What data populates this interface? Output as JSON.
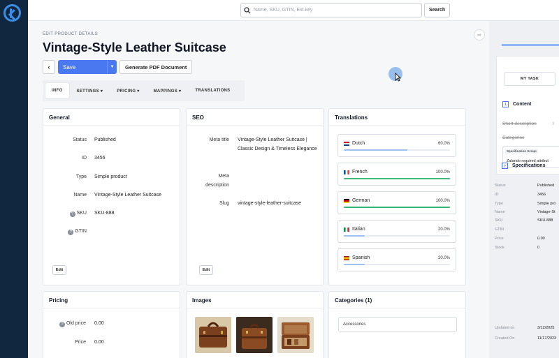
{
  "search": {
    "placeholder": "Name, SKU, GTIN, Ext.key",
    "button": "Search"
  },
  "page": {
    "breadcrumb": "EDIT PRODUCT DETAILS",
    "title": "Vintage-Style Leather Suitcase"
  },
  "toolbar": {
    "back": "‹",
    "save": "Save",
    "pdf": "Generate PDF Document"
  },
  "tabs": [
    {
      "label": "INFO",
      "active": true
    },
    {
      "label": "SETTINGS ▾"
    },
    {
      "label": "PRICING ▾"
    },
    {
      "label": "MAPPINGS ▾"
    },
    {
      "label": "TRANSLATIONS"
    }
  ],
  "general": {
    "title": "General",
    "status_label": "Status",
    "status": "Published",
    "id_label": "ID",
    "id": "3456",
    "type_label": "Type",
    "type": "Simple product",
    "name_label": "Name",
    "name": "Vintage-Style Leather Suitcase",
    "sku_label": "SKU",
    "sku": "SKU-888",
    "gtin_label": "GTIN",
    "gtin": "",
    "edit": "Edit"
  },
  "seo": {
    "title": "SEO",
    "meta_title_label": "Meta title",
    "meta_title": "Vintage-Style Leather Suitcase | Classic Design & Timeless Elegance",
    "meta_desc_label_1": "Meta",
    "meta_desc_label_2": "description",
    "slug_label": "Slug",
    "slug": "vintage-style-leather-suitcase",
    "edit": "Edit"
  },
  "translations": {
    "title": "Translations",
    "items": [
      {
        "lang": "Dutch",
        "pct": "60.0%",
        "progress": 0.6,
        "color": "#9fc1f2"
      },
      {
        "lang": "French",
        "pct": "100.0%",
        "progress": 1.0,
        "color": "#3cb77a"
      },
      {
        "lang": "German",
        "pct": "100.0%",
        "progress": 1.0,
        "color": "#3cb77a"
      },
      {
        "lang": "Italian",
        "pct": "20.0%",
        "progress": 0.2,
        "color": "#9fc1f2"
      },
      {
        "lang": "Spanish",
        "pct": "20.0%",
        "progress": 0.2,
        "color": "#9fc1f2"
      }
    ]
  },
  "pricing": {
    "title": "Pricing",
    "old_price_label": "Old price",
    "old_price": "0.00",
    "price_label": "Price",
    "price": "0.00"
  },
  "images": {
    "title": "Images"
  },
  "categories": {
    "title": "Categories (1)",
    "value": "Accessories"
  },
  "right_panel": {
    "my_task": "MY TASK",
    "content": "Content",
    "content_index": "1",
    "short_description": "Short description",
    "short_description_extra": "I",
    "categories": "Categories",
    "spec_group_label": "Specification Group",
    "spec_group_value": "Zalando required attribut",
    "specifications": "Specifications",
    "specifications_icon": ">",
    "details": [
      {
        "k": "Status",
        "v": "Published"
      },
      {
        "k": "ID",
        "v": "3456"
      },
      {
        "k": "Type",
        "v": "Simple pro"
      },
      {
        "k": "Name",
        "v": "Vintage-St"
      },
      {
        "k": "SKU",
        "v": "SKU-888"
      },
      {
        "k": "GTIN",
        "v": ""
      },
      {
        "k": "Price",
        "v": "0.00"
      },
      {
        "k": "Stock",
        "v": "0"
      }
    ],
    "updated_label": "Updated on",
    "updated": "3/12/2025",
    "created_label": "Created On",
    "created": "11/17/2023"
  }
}
